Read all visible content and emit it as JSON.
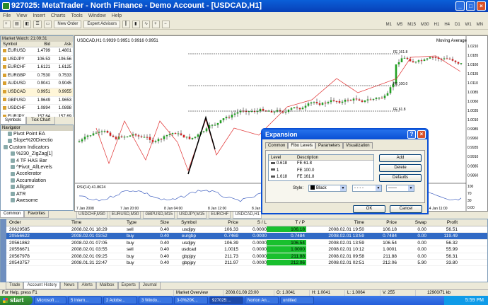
{
  "window": {
    "title": "927025: MetaTrader - North Finance - Demo Account - [USDCAD,H1]"
  },
  "menu": [
    "File",
    "View",
    "Insert",
    "Charts",
    "Tools",
    "Window",
    "Help"
  ],
  "toolbar": {
    "new_order": "New Order",
    "expert_advisors": "Expert Advisors",
    "timeframes": [
      "M1",
      "M5",
      "M15",
      "M30",
      "H1",
      "H4",
      "D1",
      "W1",
      "MN"
    ]
  },
  "market_watch": {
    "title": "Market Watch: 21:09:31",
    "headers": [
      "Symbol",
      "Bid",
      "Ask"
    ],
    "rows": [
      [
        "EURUSD",
        "1.4799",
        "1.4801"
      ],
      [
        "USDJPY",
        "106.53",
        "106.56"
      ],
      [
        "EURCHF",
        "1.6121",
        "1.6125"
      ],
      [
        "EURGBP",
        "0.7530",
        "0.7533"
      ],
      [
        "AUDUSD",
        "0.9041",
        "0.9045"
      ],
      [
        "USDCAD",
        "0.9951",
        "0.9955"
      ],
      [
        "GBPUSD",
        "1.9649",
        "1.9653"
      ],
      [
        "USDCHF",
        "1.0894",
        "1.0898"
      ],
      [
        "EURJPY",
        "157.64",
        "157.69"
      ]
    ],
    "tabs": [
      "Symbols",
      "Tick Chart"
    ]
  },
  "navigator": {
    "title": "Navigator",
    "items": [
      "Pivot Point EA",
      "Slope%20Directio",
      "Custom Indicators",
      "%230_ZigZag[1]",
      "4 TF HAS Bar",
      "^Pivot_AllLevels",
      "Accelerator",
      "Accumulation",
      "Alligator",
      "ATR",
      "Awesome"
    ],
    "tabs": [
      "Common",
      "Favorites"
    ]
  },
  "chart": {
    "header": "USDCAD,H1  0.9939 0.9951 0.9916 0.9951",
    "indicator_label": "Moving Average",
    "rsi_label": "RSI(14) 41.8624",
    "price_ticks": [
      "1.0210",
      "1.0185",
      "1.0160",
      "1.0135",
      "1.0110",
      "1.0085",
      "1.0060",
      "1.0035",
      "1.0010",
      "0.9985",
      "0.9960",
      "0.9935",
      "0.9910",
      "0.9885",
      "0.9860"
    ],
    "rsi_ticks": [
      "100",
      "70",
      "30",
      "0.00"
    ],
    "time_ticks": [
      "7 Jan 2008",
      "7 Jan 20:00",
      "8 Jan 04:00",
      "8 Jan 12:00",
      "8 Jan 20:00",
      "9 Jan 04:00",
      "9 Jan 12:00",
      "14 Jan 03:00",
      "14 Jan 11:00"
    ],
    "fibo_labels": [
      "FE 161.8",
      "FE 100.0",
      "FE 61.8"
    ]
  },
  "chart_tabs": [
    "USDCHF,M30",
    "EURUSD,M30",
    "GBPUSD,M15",
    "USDJPY,M15",
    "EURCHF",
    "USDCAD,H1"
  ],
  "dialog": {
    "title": "Expansion",
    "tabs": [
      "Common",
      "Fibo Levels",
      "Parameters",
      "Visualization"
    ],
    "headers": [
      "Level",
      "Description"
    ],
    "levels": [
      [
        "0.618",
        "FE 61.8"
      ],
      [
        "1",
        "FE 100.0"
      ],
      [
        "1.618",
        "FE 161.8"
      ]
    ],
    "buttons": {
      "add": "Add",
      "delete": "Delete",
      "defaults": "Defaults",
      "ok": "OK",
      "cancel": "Cancel"
    },
    "style_label": "Style:",
    "color_value": "Black"
  },
  "terminal": {
    "headers": [
      "Order",
      "Time",
      "Type",
      "Size",
      "Symbol",
      "Price",
      "S / L",
      "T / P",
      "Time",
      "Price",
      "Swap",
      "Profit"
    ],
    "rows": [
      [
        "20629585",
        "2008.02.01 18:29",
        "sell",
        "0.40",
        "usdjpy",
        "106.33",
        "0.0000",
        "106.18",
        "2008.02.01 19:50",
        "106.18",
        "0.00",
        "56.51"
      ],
      [
        "20556622",
        "2008.02.01 03:52",
        "buy",
        "0.40",
        "eurgbp",
        "0.7469",
        "0.0000",
        "0.7484",
        "2008.02.01 13:59",
        "0.7484",
        "0.00",
        "119.49"
      ],
      [
        "20561862",
        "2008.02.01 07:05",
        "buy",
        "0.40",
        "usdjpy",
        "106.39",
        "0.0000",
        "106.54",
        "2008.02.01 13:59",
        "106.54",
        "0.00",
        "56.32"
      ],
      [
        "20556671",
        "2008.02.01 03:55",
        "sell",
        "0.40",
        "usdcad",
        "1.0015",
        "0.0000",
        "1.0000",
        "2008.02.01 10:12",
        "1.0001",
        "0.00",
        "55.99"
      ],
      [
        "20567978",
        "2008.02.01 09:25",
        "buy",
        "0.40",
        "gbpjpy",
        "211.73",
        "0.0000",
        "211.88",
        "2008.02.01 09:58",
        "211.88",
        "0.00",
        "56.31"
      ],
      [
        "20543757",
        "2008.01.31 22:47",
        "buy",
        "0.40",
        "gbpjpy",
        "211.97",
        "0.0000",
        "212.06",
        "2008.02.01 02:51",
        "212.06",
        "5.90",
        "33.80"
      ]
    ],
    "tabs": [
      "Trade",
      "Account History",
      "News",
      "Alerts",
      "Mailbox",
      "Experts",
      "Journal"
    ]
  },
  "status": {
    "help": "For Help, press F1",
    "profile": "Market Overview",
    "time": "2008.01.08 23:00",
    "open": "O: 1.0041",
    "high": "H: 1.0041",
    "low": "L: 1.0064",
    "volume": "V: 255",
    "traffic": "12900/71 kb"
  },
  "taskbar": {
    "start": "start",
    "items": [
      "Microsoft ...",
      "5 Intern...",
      "2 Adobe...",
      "3 Windo...",
      "3-0%20K...",
      "927025:...",
      "Norton An...",
      "untitled"
    ],
    "clock": "5:59 PM"
  }
}
